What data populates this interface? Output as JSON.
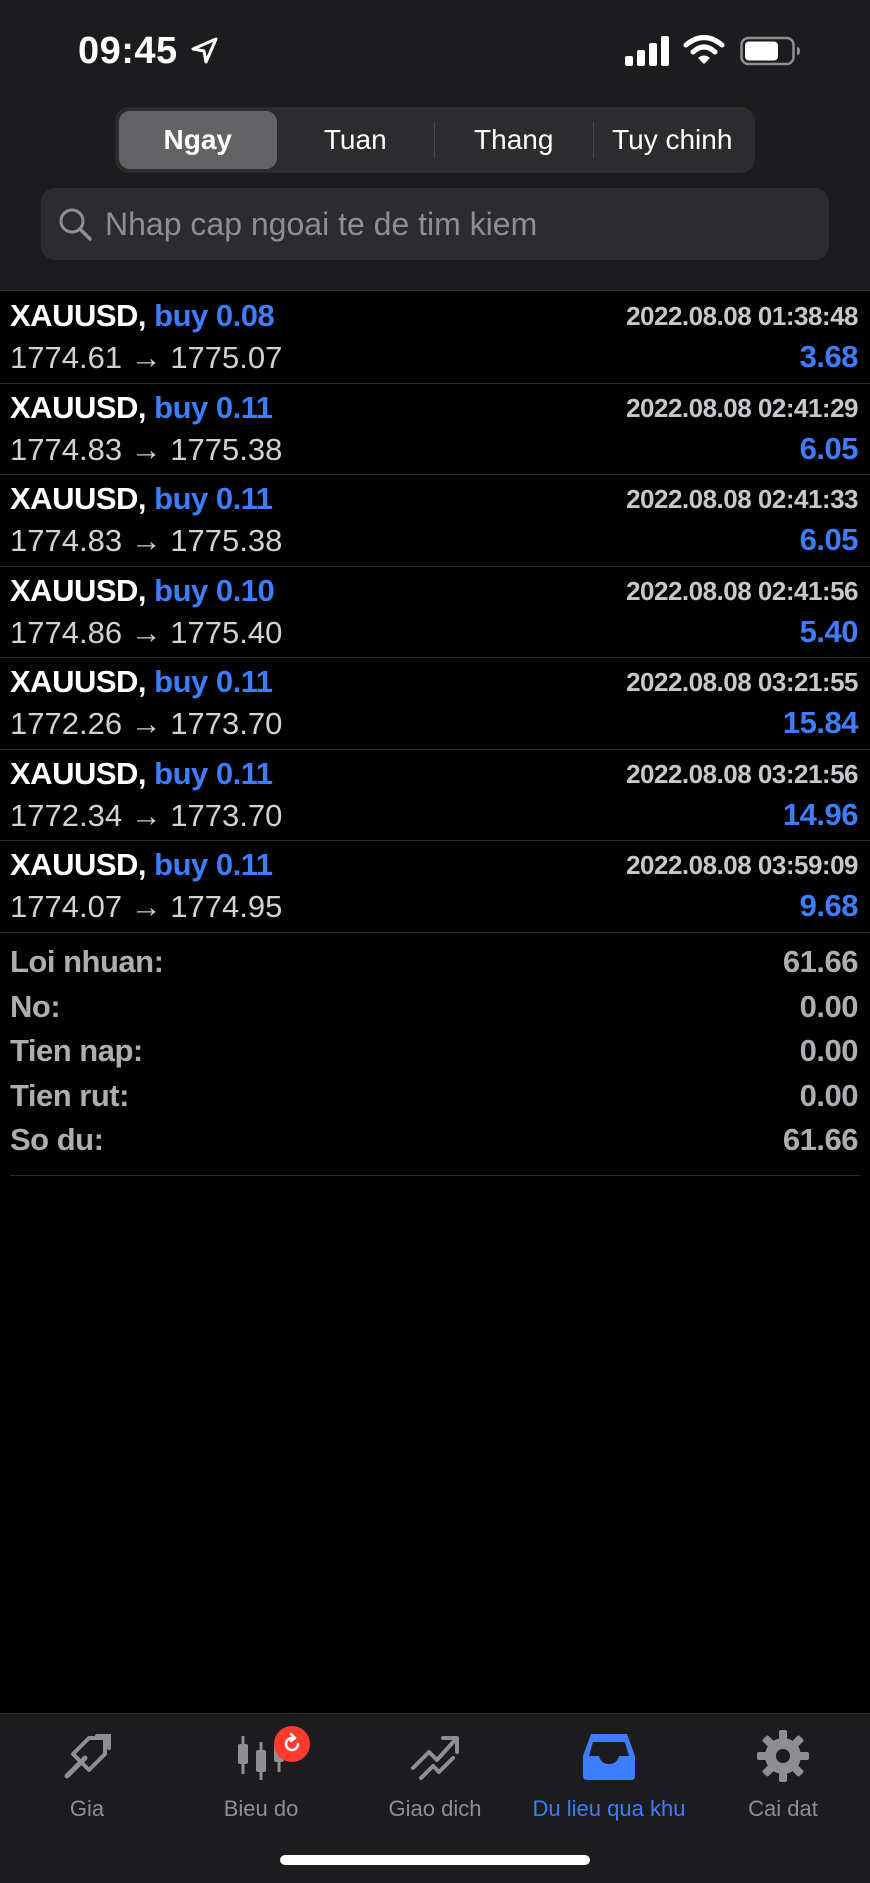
{
  "status": {
    "time": "09:45"
  },
  "tabs_period": [
    {
      "label": "Ngay",
      "active": true
    },
    {
      "label": "Tuan",
      "active": false
    },
    {
      "label": "Thang",
      "active": false
    },
    {
      "label": "Tuy chinh",
      "active": false
    }
  ],
  "search": {
    "placeholder": "Nhap cap ngoai te de tim kiem",
    "value": ""
  },
  "trades": [
    {
      "symbol": "XAUUSD,",
      "side": "buy 0.08",
      "time": "2022.08.08 01:38:48",
      "prices": "1774.61 → 1775.07",
      "profit": "3.68"
    },
    {
      "symbol": "XAUUSD,",
      "side": "buy 0.11",
      "time": "2022.08.08 02:41:29",
      "prices": "1774.83 → 1775.38",
      "profit": "6.05"
    },
    {
      "symbol": "XAUUSD,",
      "side": "buy 0.11",
      "time": "2022.08.08 02:41:33",
      "prices": "1774.83 → 1775.38",
      "profit": "6.05"
    },
    {
      "symbol": "XAUUSD,",
      "side": "buy 0.10",
      "time": "2022.08.08 02:41:56",
      "prices": "1774.86 → 1775.40",
      "profit": "5.40"
    },
    {
      "symbol": "XAUUSD,",
      "side": "buy 0.11",
      "time": "2022.08.08 03:21:55",
      "prices": "1772.26 → 1773.70",
      "profit": "15.84"
    },
    {
      "symbol": "XAUUSD,",
      "side": "buy 0.11",
      "time": "2022.08.08 03:21:56",
      "prices": "1772.34 → 1773.70",
      "profit": "14.96"
    },
    {
      "symbol": "XAUUSD,",
      "side": "buy 0.11",
      "time": "2022.08.08 03:59:09",
      "prices": "1774.07 → 1774.95",
      "profit": "9.68"
    }
  ],
  "summary": [
    {
      "label": "Loi nhuan:",
      "value": "61.66"
    },
    {
      "label": "No:",
      "value": "0.00"
    },
    {
      "label": "Tien nap:",
      "value": "0.00"
    },
    {
      "label": "Tien rut:",
      "value": "0.00"
    },
    {
      "label": "So du:",
      "value": "61.66"
    }
  ],
  "tabbar": [
    {
      "label": "Gia",
      "icon": "quotes-icon",
      "active": false
    },
    {
      "label": "Bieu do",
      "icon": "candlestick-chart-icon",
      "active": false
    },
    {
      "label": "Giao dich",
      "icon": "trade-icon",
      "active": false
    },
    {
      "label": "Du lieu qua khu",
      "icon": "history-inbox-icon",
      "active": true
    },
    {
      "label": "Cai dat",
      "icon": "gear-icon",
      "active": false
    }
  ],
  "colors": {
    "accent": "#3d7dff",
    "badge": "#ff3b30",
    "background": "#000000",
    "header": "#1c1c1e"
  }
}
